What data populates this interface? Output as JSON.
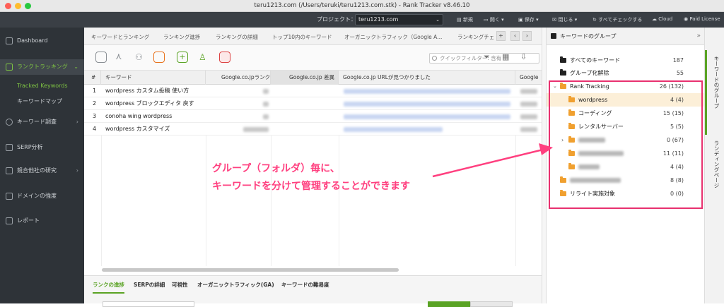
{
  "window": {
    "title": "teru1213.com (/Users/teruki/teru1213.com.stk) - Rank Tracker v8.46.10"
  },
  "toolbar": {
    "project_label": "プロジェクト：",
    "project_value": "teru1213.com",
    "buttons": [
      "新規",
      "開く",
      "保存",
      "閉じる",
      "すべてチェックする",
      "Cloud",
      "Paid License"
    ]
  },
  "sidebar": {
    "items": [
      {
        "label": "Dashboard",
        "icon": "dashboard-icon"
      },
      {
        "label": "ランクトラッキング",
        "icon": "rank-tracking-icon"
      },
      {
        "label": "キーワード調査",
        "icon": "search-icon"
      },
      {
        "label": "SERP分析",
        "icon": "serp-icon"
      },
      {
        "label": "競合他社の研究",
        "icon": "competitor-icon"
      },
      {
        "label": "ドメインの強度",
        "icon": "domain-icon"
      },
      {
        "label": "レポート",
        "icon": "report-icon"
      }
    ],
    "subitems": [
      "Tracked Keywords",
      "キーワードマップ"
    ]
  },
  "tabs": [
    "キーワードとランキング",
    "ランキング進捗",
    "ランキングの詳細",
    "トップ10内のキーワード",
    "オーガニックトラフィック（Google A...",
    "ランキングチェ"
  ],
  "filter": {
    "placeholder": "クイックフィルター: 含有"
  },
  "table": {
    "columns": [
      "#",
      "キーワード",
      "Google.co.jpランク",
      "Google.co.jp 差異",
      "Google.co.jp URLが見つかりました",
      "Google"
    ],
    "rows": [
      {
        "num": "1",
        "keyword": "wordpress カスタム投稿 使い方"
      },
      {
        "num": "2",
        "keyword": "wordpress ブロックエディタ 戻す"
      },
      {
        "num": "3",
        "keyword": "conoha wing wordpress"
      },
      {
        "num": "4",
        "keyword": "wordpress カスタマイズ"
      }
    ]
  },
  "bottom_tabs": [
    "ランクの進捗",
    "SERPの詳細",
    "可視性",
    "オーガニックトラフィック(GA)",
    "キーワードの難易度"
  ],
  "panel": {
    "title": "キーワードのグループ",
    "rows": [
      {
        "label": "すべてのキーワード",
        "count": "187"
      },
      {
        "label": "グループ化解除",
        "count": "55"
      },
      {
        "label": "Rank Tracking",
        "count": "26 (132)"
      },
      {
        "label": "wordpress",
        "count": "4 (4)"
      },
      {
        "label": "コーディング",
        "count": "15 (15)"
      },
      {
        "label": "レンタルサーバー",
        "count": "5 (5)"
      },
      {
        "label": "",
        "count": "0 (67)"
      },
      {
        "label": "",
        "count": "11 (11)"
      },
      {
        "label": "",
        "count": "4 (4)"
      },
      {
        "label": "",
        "count": "8 (8)"
      },
      {
        "label": "リライト実施対象",
        "count": "0 (0)"
      }
    ]
  },
  "vertical_tabs": [
    "キーワードのグループ",
    "ランディングページ"
  ],
  "annotation": {
    "line1": "グループ（フォルダ）毎に、",
    "line2": "キーワードを分けて管理することができます"
  },
  "colors": {
    "accent_green": "#7dc243",
    "highlight_pink": "#e8316f",
    "folder_orange": "#f0a030"
  }
}
